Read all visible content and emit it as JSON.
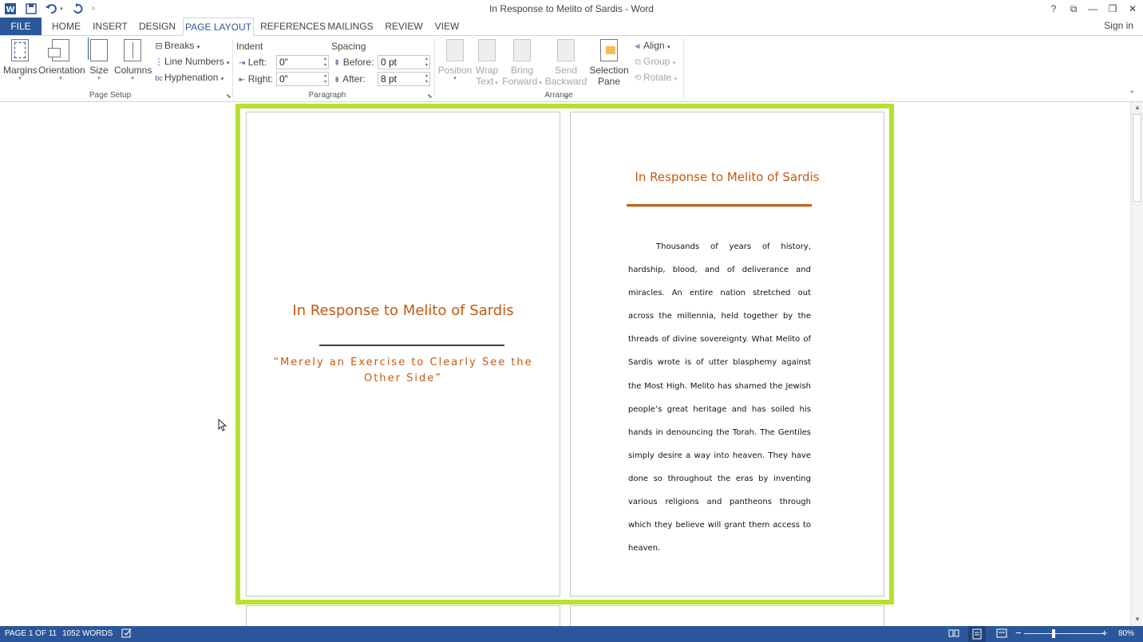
{
  "app": {
    "window_title": "In Response to Melito of Sardis - Word",
    "quick_access": {
      "word_icon": "word-logo-icon",
      "save_icon": "save-icon",
      "undo_icon": "undo-icon",
      "redo_icon": "redo-icon"
    },
    "window_buttons": [
      "?",
      "⧉",
      "—",
      "❐",
      "✕"
    ],
    "sign_in": "Sign in"
  },
  "tabs": [
    {
      "label": "FILE"
    },
    {
      "label": "HOME"
    },
    {
      "label": "INSERT"
    },
    {
      "label": "DESIGN"
    },
    {
      "label": "PAGE LAYOUT",
      "active": true
    },
    {
      "label": "REFERENCES"
    },
    {
      "label": "MAILINGS"
    },
    {
      "label": "REVIEW"
    },
    {
      "label": "VIEW"
    }
  ],
  "ribbon": {
    "page_setup": {
      "label": "Page Setup",
      "margins": "Margins",
      "orientation": "Orientation",
      "size": "Size",
      "columns": "Columns",
      "breaks": "Breaks",
      "line_numbers": "Line Numbers",
      "hyphenation": "Hyphenation"
    },
    "paragraph": {
      "label": "Paragraph",
      "indent": "Indent",
      "spacing": "Spacing",
      "left_label": "Left:",
      "left_value": "0\"",
      "right_label": "Right:",
      "right_value": "0\"",
      "before_label": "Before:",
      "before_value": "0 pt",
      "after_label": "After:",
      "after_value": "8 pt"
    },
    "arrange": {
      "label": "Arrange",
      "position": "Position",
      "wrap_text_1": "Wrap",
      "wrap_text_2": "Text",
      "bring_forward_1": "Bring",
      "bring_forward_2": "Forward",
      "send_backward_1": "Send",
      "send_backward_2": "Backward",
      "selection_pane_1": "Selection",
      "selection_pane_2": "Pane",
      "align": "Align",
      "group": "Group",
      "rotate": "Rotate"
    }
  },
  "document": {
    "cover_title": "In Response to Melito of Sardis",
    "cover_subtitle": "“Merely an Exercise to Clearly See the Other Side”",
    "page2_title": "In Response to Melito of Sardis",
    "page2_body": "Thousands of years of history, hardship, blood, and of deliverance and miracles. An entire nation stretched out across the millennia, held together by the threads of divine sovereignty. What Melito of Sardis wrote is of utter blasphemy against the Most High. Melito has shamed the Jewish people’s great heritage and has soiled his hands in denouncing the Torah. The Gentiles simply desire a way into heaven. They have done so throughout the eras by inventing various religions and pantheons through which they believe will grant them access to heaven.",
    "selection_color": "#b7e12a",
    "accent_color": "#c55a11"
  },
  "status": {
    "page": "PAGE 1 OF 11",
    "words": "1052 WORDS",
    "zoom_minus": "−",
    "zoom_plus": "+",
    "zoom": "80%",
    "zoom_level_fraction": 0.37
  }
}
